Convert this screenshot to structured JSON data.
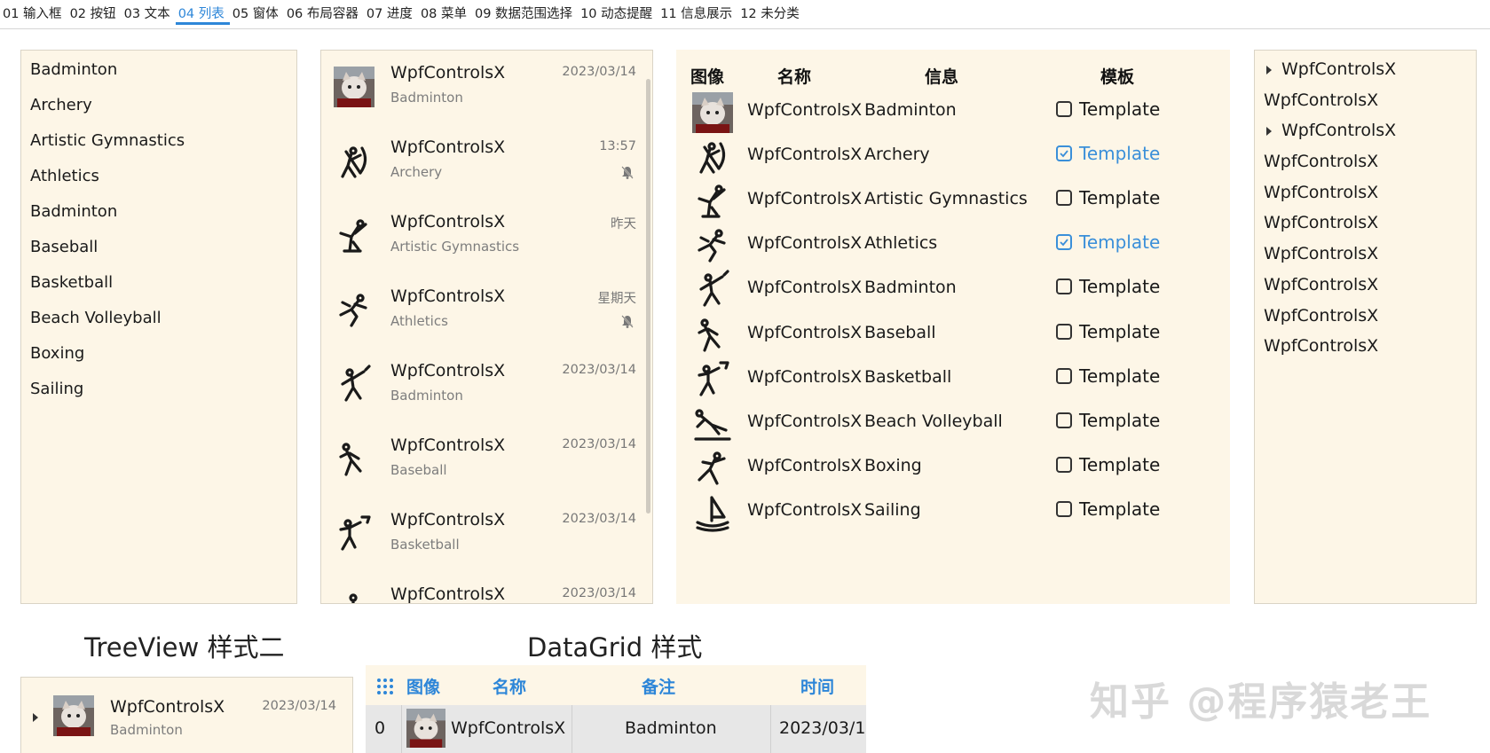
{
  "tabs": [
    "01 输入框",
    "02 按钮",
    "03 文本",
    "04 列表",
    "05 窗体",
    "06 布局容器",
    "07 进度",
    "08 菜单",
    "09 数据范围选择",
    "10 动态提醒",
    "11 信息展示",
    "12 未分类"
  ],
  "active_tab_index": 3,
  "list_simple": [
    "Badminton",
    "Archery",
    "Artistic Gymnastics",
    "Athletics",
    "Badminton",
    "Baseball",
    "Basketball",
    "Beach Volleyball",
    "Boxing",
    "Sailing"
  ],
  "list_chat": [
    {
      "name": "WpfControlsX",
      "sub": "Badminton",
      "time": "2023/03/14",
      "muted": false,
      "icon": "cat-avatar"
    },
    {
      "name": "WpfControlsX",
      "sub": "Archery",
      "time": "13:57",
      "muted": true,
      "icon": "archery-icon"
    },
    {
      "name": "WpfControlsX",
      "sub": "Artistic Gymnastics",
      "time": "昨天",
      "muted": false,
      "icon": "gymnastics-icon"
    },
    {
      "name": "WpfControlsX",
      "sub": "Athletics",
      "time": "星期天",
      "muted": true,
      "icon": "athletics-icon"
    },
    {
      "name": "WpfControlsX",
      "sub": "Badminton",
      "time": "2023/03/14",
      "muted": false,
      "icon": "badminton-icon"
    },
    {
      "name": "WpfControlsX",
      "sub": "Baseball",
      "time": "2023/03/14",
      "muted": false,
      "icon": "baseball-icon"
    },
    {
      "name": "WpfControlsX",
      "sub": "Basketball",
      "time": "2023/03/14",
      "muted": false,
      "icon": "basketball-icon"
    },
    {
      "name": "WpfControlsX",
      "sub": "",
      "time": "2023/03/14",
      "muted": false,
      "icon": "sport-icon"
    }
  ],
  "grid": {
    "headers": {
      "image": "图像",
      "name": "名称",
      "info": "信息",
      "template": "模板"
    },
    "rows": [
      {
        "name": "WpfControlsX",
        "info": "Badminton",
        "template": "Template",
        "checked": false,
        "icon": "cat-avatar"
      },
      {
        "name": "WpfControlsX",
        "info": "Archery",
        "template": "Template",
        "checked": true,
        "icon": "archery-icon"
      },
      {
        "name": "WpfControlsX",
        "info": "Artistic Gymnastics",
        "template": "Template",
        "checked": false,
        "icon": "gymnastics-icon"
      },
      {
        "name": "WpfControlsX",
        "info": "Athletics",
        "template": "Template",
        "checked": true,
        "icon": "athletics-icon"
      },
      {
        "name": "WpfControlsX",
        "info": "Badminton",
        "template": "Template",
        "checked": false,
        "icon": "badminton-icon"
      },
      {
        "name": "WpfControlsX",
        "info": "Baseball",
        "template": "Template",
        "checked": false,
        "icon": "baseball-icon"
      },
      {
        "name": "WpfControlsX",
        "info": "Basketball",
        "template": "Template",
        "checked": false,
        "icon": "basketball-icon"
      },
      {
        "name": "WpfControlsX",
        "info": "Beach Volleyball",
        "template": "Template",
        "checked": false,
        "icon": "beach-volleyball-icon"
      },
      {
        "name": "WpfControlsX",
        "info": "Boxing",
        "template": "Template",
        "checked": false,
        "icon": "boxing-icon"
      },
      {
        "name": "WpfControlsX",
        "info": "Sailing",
        "template": "Template",
        "checked": false,
        "icon": "sailing-icon"
      }
    ]
  },
  "tree": [
    {
      "label": "WpfControlsX",
      "expander": true
    },
    {
      "label": "WpfControlsX",
      "expander": false
    },
    {
      "label": "WpfControlsX",
      "expander": true
    },
    {
      "label": "WpfControlsX",
      "expander": false
    },
    {
      "label": "WpfControlsX",
      "expander": false
    },
    {
      "label": "WpfControlsX",
      "expander": false
    },
    {
      "label": "WpfControlsX",
      "expander": false
    },
    {
      "label": "WpfControlsX",
      "expander": false
    },
    {
      "label": "WpfControlsX",
      "expander": false
    },
    {
      "label": "WpfControlsX",
      "expander": false
    }
  ],
  "treeview2": {
    "title": "TreeView 样式二",
    "item": {
      "name": "WpfControlsX",
      "sub": "Badminton",
      "time": "2023/03/14"
    }
  },
  "datagrid": {
    "title": "DataGrid 样式",
    "headers": {
      "image": "图像",
      "name": "名称",
      "note": "备注",
      "time": "时间"
    },
    "row": {
      "index": "0",
      "name": "WpfControlsX",
      "note": "Badminton",
      "time": "2023/03/1"
    }
  },
  "watermark": "知乎 @程序猿老王",
  "colors": {
    "accent": "#2d86d8",
    "panel_bg": "#fdf6e7",
    "checked": "#3a8fd9"
  }
}
